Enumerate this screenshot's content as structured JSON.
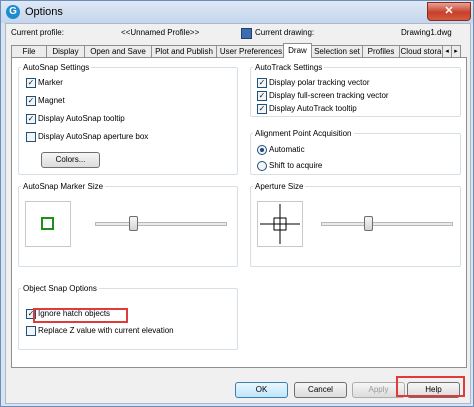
{
  "window": {
    "title": "Options",
    "app_icon": "G"
  },
  "profile": {
    "current_profile_label": "Current profile:",
    "current_profile_value": "<<Unnamed Profile>>",
    "current_drawing_label": "Current drawing:",
    "current_drawing_value": "Drawing1.dwg"
  },
  "tabs": [
    "File",
    "Display",
    "Open and Save",
    "Plot and Publish",
    "User Preferences",
    "Draw",
    "Selection set",
    "Profiles",
    "Cloud stora"
  ],
  "active_tab": "Draw",
  "autosnap_settings": {
    "title": "AutoSnap Settings",
    "items": [
      {
        "label": "Marker",
        "checked": true
      },
      {
        "label": "Magnet",
        "checked": true
      },
      {
        "label": "Display AutoSnap tooltip",
        "checked": true
      },
      {
        "label": "Display AutoSnap aperture box",
        "checked": false
      }
    ],
    "colors_button": "Colors..."
  },
  "autotrack_settings": {
    "title": "AutoTrack Settings",
    "items": [
      {
        "label": "Display polar tracking vector",
        "checked": true
      },
      {
        "label": "Display full-screen tracking vector",
        "checked": true
      },
      {
        "label": "Display AutoTrack tooltip",
        "checked": true
      }
    ]
  },
  "alignment": {
    "title": "Alignment Point Acquisition",
    "options": [
      {
        "label": "Automatic",
        "selected": true
      },
      {
        "label": "Shift to acquire",
        "selected": false
      }
    ]
  },
  "marker_size": {
    "title": "AutoSnap Marker Size",
    "marker_color": "#1f8f1f"
  },
  "aperture_size": {
    "title": "Aperture Size"
  },
  "object_snap": {
    "title": "Object Snap Options",
    "items": [
      {
        "label": "Ignore hatch objects",
        "checked": true
      },
      {
        "label": "Replace Z value with current elevation",
        "checked": false
      }
    ]
  },
  "buttons": {
    "ok": "OK",
    "cancel": "Cancel",
    "apply": "Apply",
    "help": "Help"
  },
  "colors": {
    "highlight": "#e23a3a"
  }
}
